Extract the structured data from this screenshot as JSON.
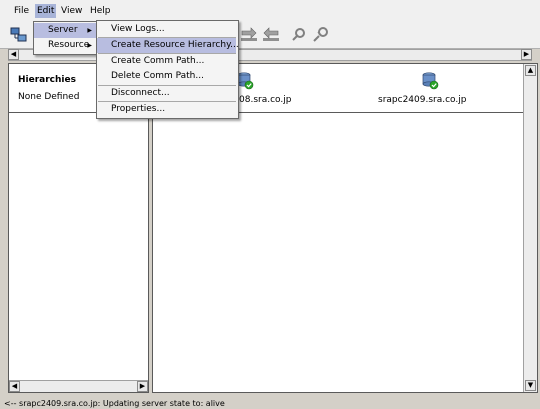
{
  "menubar": {
    "file": "File",
    "edit": "Edit",
    "view": "View",
    "help": "Help"
  },
  "edit_menu": {
    "items": [
      "Server",
      "Resource"
    ]
  },
  "server_submenu": {
    "items": [
      "View Logs...",
      "Create Resource Hierarchy...",
      "Create Comm Path...",
      "Delete Comm Path...",
      "Disconnect...",
      "Properties..."
    ]
  },
  "left_panel": {
    "title": "Hierarchies",
    "value": "None Defined"
  },
  "servers": [
    {
      "name": "08.sra.co.jp"
    },
    {
      "name": "srapc2409.sra.co.jp"
    }
  ],
  "status": {
    "text": "<-- srapc2409.sra.co.jp: Updating server state to: alive"
  },
  "colors": {
    "menu_highlight": "#b8bde0",
    "menubar_active": "#a8b4d8",
    "server_ok": "#2aa52a"
  }
}
